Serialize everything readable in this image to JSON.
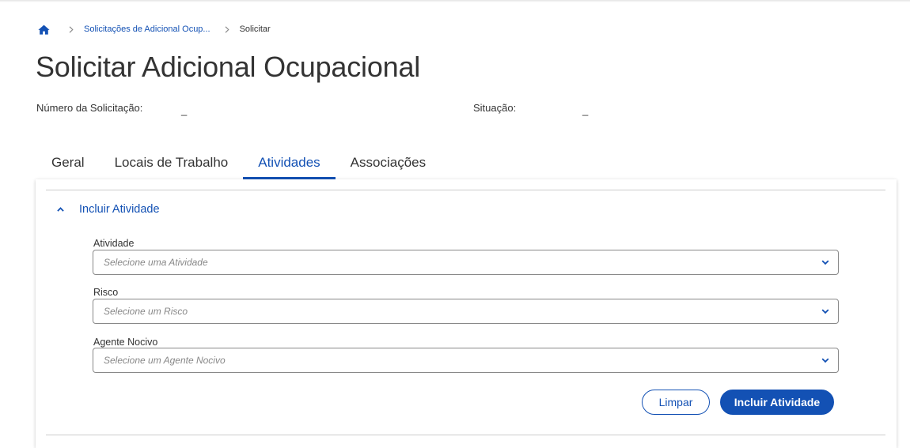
{
  "breadcrumb": {
    "home_icon": "home-icon",
    "separator_icon": "chevron-right-icon",
    "items": [
      {
        "label": "Solicitações de Adicional Ocup..."
      },
      {
        "label": "Solicitar"
      }
    ]
  },
  "page": {
    "title": "Solicitar Adicional Ocupacional",
    "request_number_label": "Número da Solicitação:",
    "request_number_value": "_",
    "status_label": "Situação:",
    "status_value": "_"
  },
  "tabs": [
    {
      "label": "Geral",
      "active": false
    },
    {
      "label": "Locais de Trabalho",
      "active": false
    },
    {
      "label": "Atividades",
      "active": true
    },
    {
      "label": "Associações",
      "active": false
    }
  ],
  "section": {
    "title": "Incluir Atividade",
    "expanded": true,
    "toggle_icon": "chevron-up-icon"
  },
  "form": {
    "fields": [
      {
        "label": "Atividade",
        "placeholder": "Selecione uma Atividade"
      },
      {
        "label": "Risco",
        "placeholder": "Selecione um Risco"
      },
      {
        "label": "Agente Nocivo",
        "placeholder": "Selecione um Agente Nocivo"
      }
    ],
    "clear_button": "Limpar",
    "submit_button": "Incluir Atividade"
  },
  "colors": {
    "primary": "#1351b4",
    "text": "#333333",
    "placeholder": "#888888",
    "border": "#888888",
    "divider": "#cccccc"
  }
}
